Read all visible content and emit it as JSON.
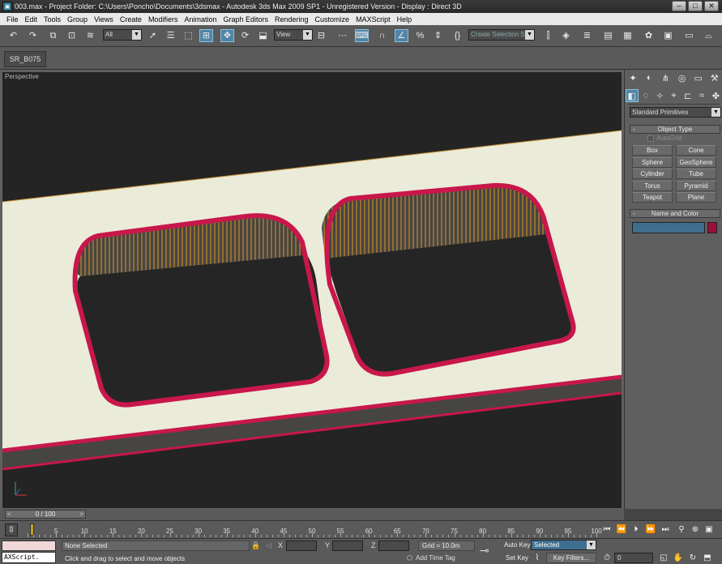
{
  "window": {
    "title": "003.max     - Project Folder: C:\\Users\\Poncho\\Documents\\3dsmax     - Autodesk 3ds Max  2009 SP1    - Unregistered Version    - Display : Direct 3D"
  },
  "menu": [
    "File",
    "Edit",
    "Tools",
    "Group",
    "Views",
    "Create",
    "Modifiers",
    "Animation",
    "Graph Editors",
    "Rendering",
    "Customize",
    "MAXScript",
    "Help"
  ],
  "toolbar": {
    "selection_filter": "All",
    "ref_coord": "View",
    "named_selection_placeholder": "Create Selection Se",
    "icons": [
      "undo-icon",
      "redo-icon",
      "select-and-link-icon",
      "unlink-icon",
      "bind-space-warp-icon",
      "select-object-icon",
      "select-by-name-icon",
      "rectangular-selection-icon",
      "window-crossing-icon",
      "select-move-icon",
      "select-rotate-icon",
      "select-scale-icon",
      "pivot-center-icon",
      "select-manipulate-icon",
      "keyboard-shortcut-icon",
      "snap-toggle-icon",
      "angle-snap-icon",
      "percent-snap-icon",
      "spinner-snap-icon",
      "edit-named-selection-icon",
      "mirror-icon",
      "align-icon",
      "layer-manager-icon",
      "curve-editor-icon",
      "schematic-view-icon",
      "material-editor-icon",
      "render-setup-icon",
      "rendered-frame-icon",
      "quick-render-icon"
    ]
  },
  "ribbon": {
    "tab_label": "SR_B075"
  },
  "viewport": {
    "label": "Perspective",
    "colors": {
      "background": "#242424",
      "countertop": "#ebebd9",
      "edge": "#c8174b",
      "inner_wall": "#474542",
      "wall_seam": "#f0a020"
    }
  },
  "command_panel": {
    "tabs": [
      "create-tab-icon",
      "modify-tab-icon",
      "hierarchy-tab-icon",
      "motion-tab-icon",
      "display-tab-icon",
      "utilities-tab-icon"
    ],
    "subtabs": [
      "geometry-icon",
      "shapes-icon",
      "lights-icon",
      "cameras-icon",
      "helpers-icon",
      "space-warps-icon",
      "systems-icon"
    ],
    "category": "Standard Primitives",
    "object_type_title": "Object Type",
    "autogrid_label": "AutoGrid",
    "primitives": [
      "Box",
      "Cone",
      "Sphere",
      "GeoSphere",
      "Cylinder",
      "Tube",
      "Torus",
      "Pyramid",
      "Teapot",
      "Plane"
    ],
    "name_color_title": "Name and Color",
    "object_name": "",
    "object_color": "#9a0f3a"
  },
  "timeline": {
    "slider_label": "0 / 100",
    "prev_arrow": "<",
    "next_arrow": ">",
    "ticks": [
      "5",
      "10",
      "15",
      "20",
      "25",
      "30",
      "35",
      "40",
      "45",
      "50",
      "55",
      "60",
      "65",
      "70",
      "75",
      "80",
      "85",
      "90",
      "95",
      "100"
    ]
  },
  "status": {
    "maxscript_line": "AXScript.",
    "selection": "None Selected",
    "prompt": "Click and drag to select and move objects",
    "coords": {
      "x_label": "X",
      "y_label": "Y",
      "z_label": "Z"
    },
    "grid": "Grid = 10.0m",
    "add_time_tag": "Add Time Tag",
    "auto_key": "Auto Key",
    "set_key": "Set Key",
    "selected_mode": "Selected",
    "key_filters": "Key Filters...",
    "current_frame": "0"
  }
}
